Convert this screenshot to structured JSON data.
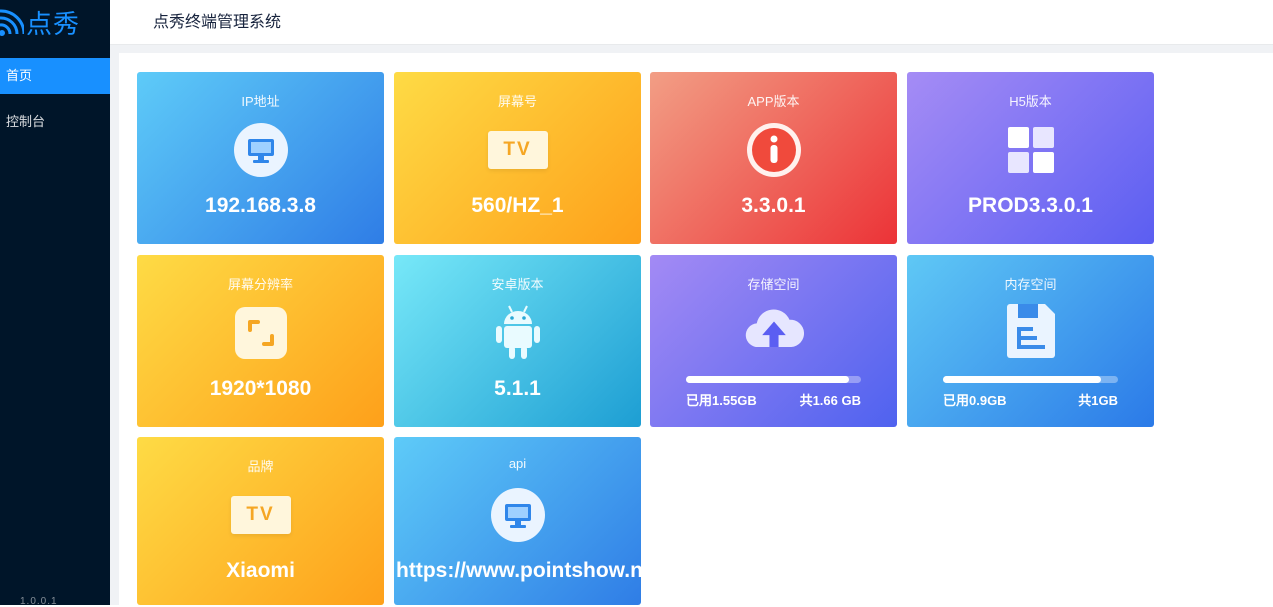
{
  "brand": {
    "name": "点秀",
    "logo_icon": "wifi-signal-icon"
  },
  "header": {
    "title": "点秀终端管理系统"
  },
  "sidebar": {
    "items": [
      {
        "label": "首页",
        "active": true
      },
      {
        "label": "控制台",
        "active": false
      }
    ],
    "version": "1.0.0.1"
  },
  "cards": {
    "ip": {
      "label": "IP地址",
      "value": "192.168.3.8",
      "icon": "monitor-icon"
    },
    "screen_no": {
      "label": "屏幕号",
      "value": "560/HZ_1",
      "icon": "tv-icon",
      "icon_text": "TV"
    },
    "app_version": {
      "label": "APP版本",
      "value": "3.3.0.1",
      "icon": "info-icon"
    },
    "h5_version": {
      "label": "H5版本",
      "value": "PROD3.3.0.1",
      "icon": "grid-icon"
    },
    "resolution": {
      "label": "屏幕分辨率",
      "value": "1920*1080",
      "icon": "expand-icon"
    },
    "android": {
      "label": "安卓版本",
      "value": "5.1.1",
      "icon": "android-icon"
    },
    "storage": {
      "label": "存储空间",
      "used": "已用1.55GB",
      "total": "共1.66 GB",
      "used_fraction": 0.934,
      "icon": "cloud-upload-icon"
    },
    "memory": {
      "label": "内存空间",
      "used": "已用0.9GB",
      "total": "共1GB",
      "used_fraction": 0.9,
      "icon": "save-icon"
    },
    "brand": {
      "label": "品牌",
      "value": "Xiaomi",
      "icon": "tv-icon",
      "icon_text": "TV"
    },
    "api": {
      "label": "api",
      "value": "https://www.pointshow.n",
      "icon": "monitor-icon"
    }
  }
}
